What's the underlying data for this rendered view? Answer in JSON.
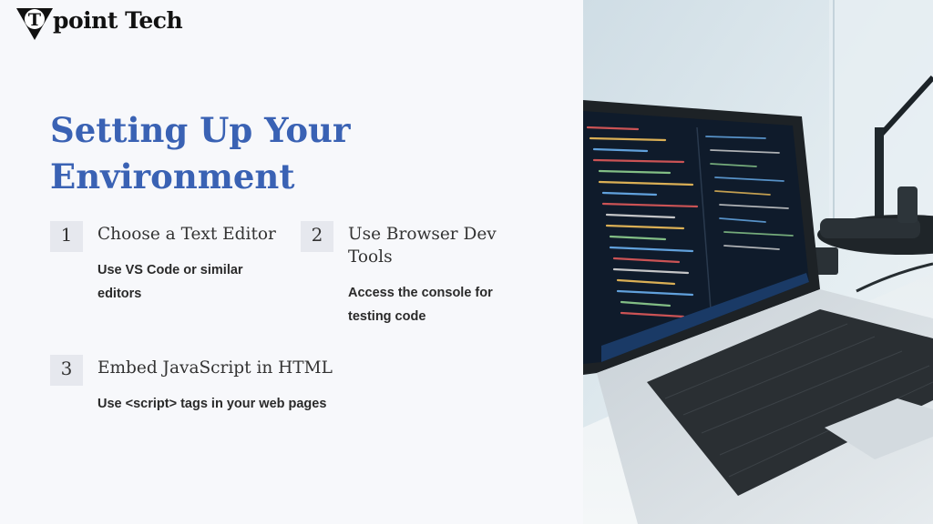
{
  "logo": {
    "letter": "T",
    "text": "point Tech"
  },
  "title": "Setting Up Your Environment",
  "steps": [
    {
      "number": "1",
      "title": "Choose a Text Editor",
      "desc": "Use VS Code or similar editors"
    },
    {
      "number": "2",
      "title": "Use Browser Dev Tools",
      "desc": "Access the console for testing code"
    },
    {
      "number": "3",
      "title": "Embed JavaScript in HTML",
      "desc": "Use <script> tags in your web pages"
    }
  ],
  "colors": {
    "title": "#3a62b4",
    "badge": "#e6e8ee",
    "background": "#f7f8fb"
  },
  "photo": {
    "subject": "laptop-with-code-editor"
  }
}
